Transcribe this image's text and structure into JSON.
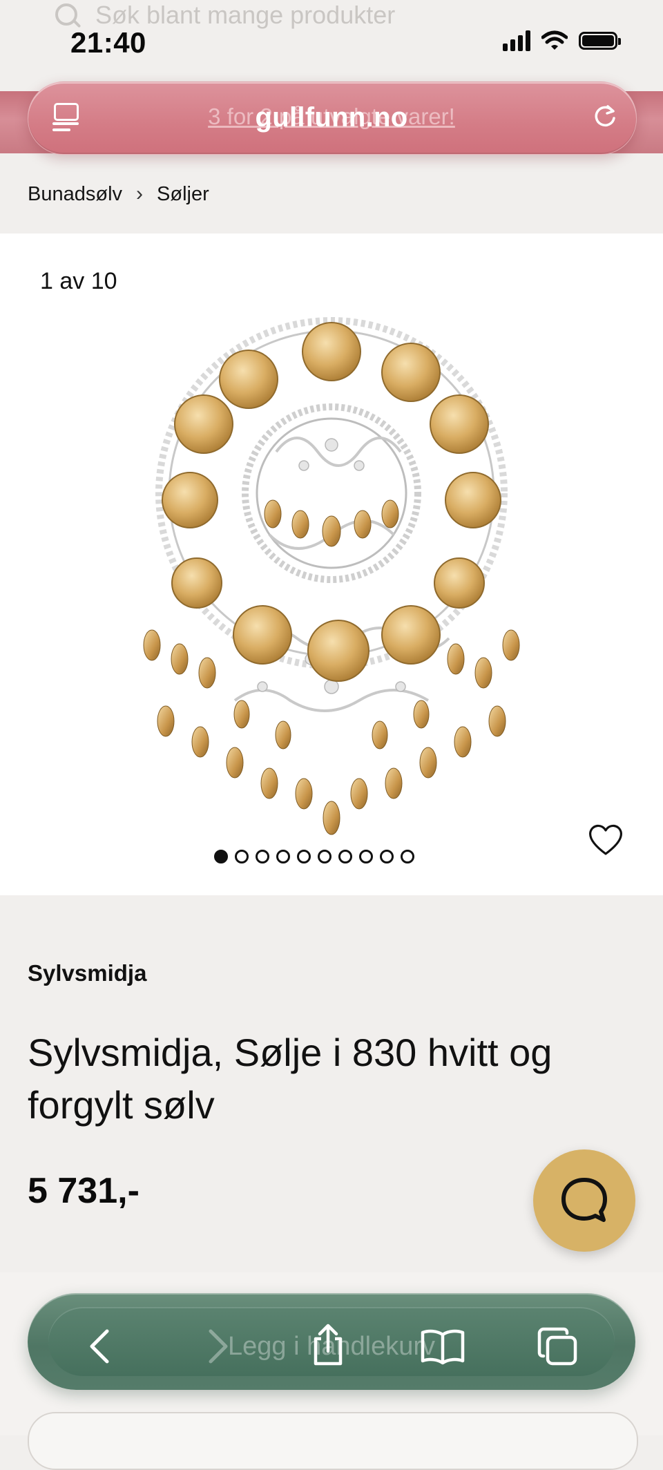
{
  "status_bar": {
    "time": "21:40"
  },
  "background_search": {
    "placeholder": "Søk blant mange produkter"
  },
  "browser": {
    "url": "gullfunn.no",
    "promo_ghost_text": "3 for 2 på utvalgte varer!"
  },
  "breadcrumb": [
    {
      "label": "Bunadsølv"
    },
    {
      "label": "Søljer"
    }
  ],
  "gallery": {
    "counter": "1 av 10",
    "total_images": 10,
    "active_index": 1,
    "image_icon": "solje-brooch-image"
  },
  "product": {
    "brand": "Sylvsmidja",
    "title": "Sylvsmidja, Sølje i 830 hvitt og forgylt sølv",
    "price": "5 731,-"
  },
  "bottom_cta": {
    "label": "Legg i handlekurv"
  },
  "icons": {
    "tabs": "tab-overview-icon",
    "reload": "reload-icon",
    "favorite": "heart-icon",
    "chat": "chat-bubble-icon",
    "back": "chevron-left-icon",
    "forward": "chevron-right-icon",
    "share": "share-icon",
    "bookmarks": "book-icon",
    "tabs_bottom": "tabs-icon"
  },
  "colors": {
    "promo": "#d47c86",
    "chat_button": "#d7b266",
    "toolbar": "#4f7664",
    "page_bg": "#f1efed"
  }
}
